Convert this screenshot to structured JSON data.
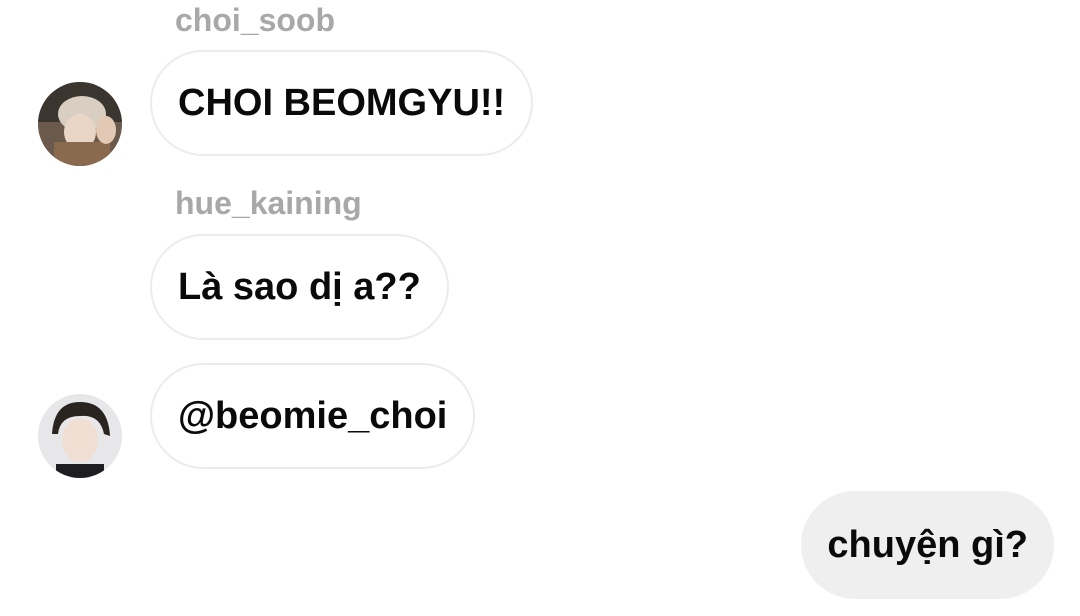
{
  "messages": [
    {
      "sender": "choi_soob",
      "text": "CHOI BEOMGYU!!",
      "avatar": "user-avatar-photo"
    },
    {
      "sender": "hue_kaining",
      "text": "Là sao dị a??"
    },
    {
      "text": "@beomie_choi",
      "avatar": "user-avatar-photo"
    }
  ],
  "own_message": {
    "text": "chuyện gì?"
  },
  "colors": {
    "sender_name": "#a8a8a8",
    "bubble_border": "#ececec",
    "own_bubble_bg": "#efefef",
    "text": "#0a0a0a"
  }
}
